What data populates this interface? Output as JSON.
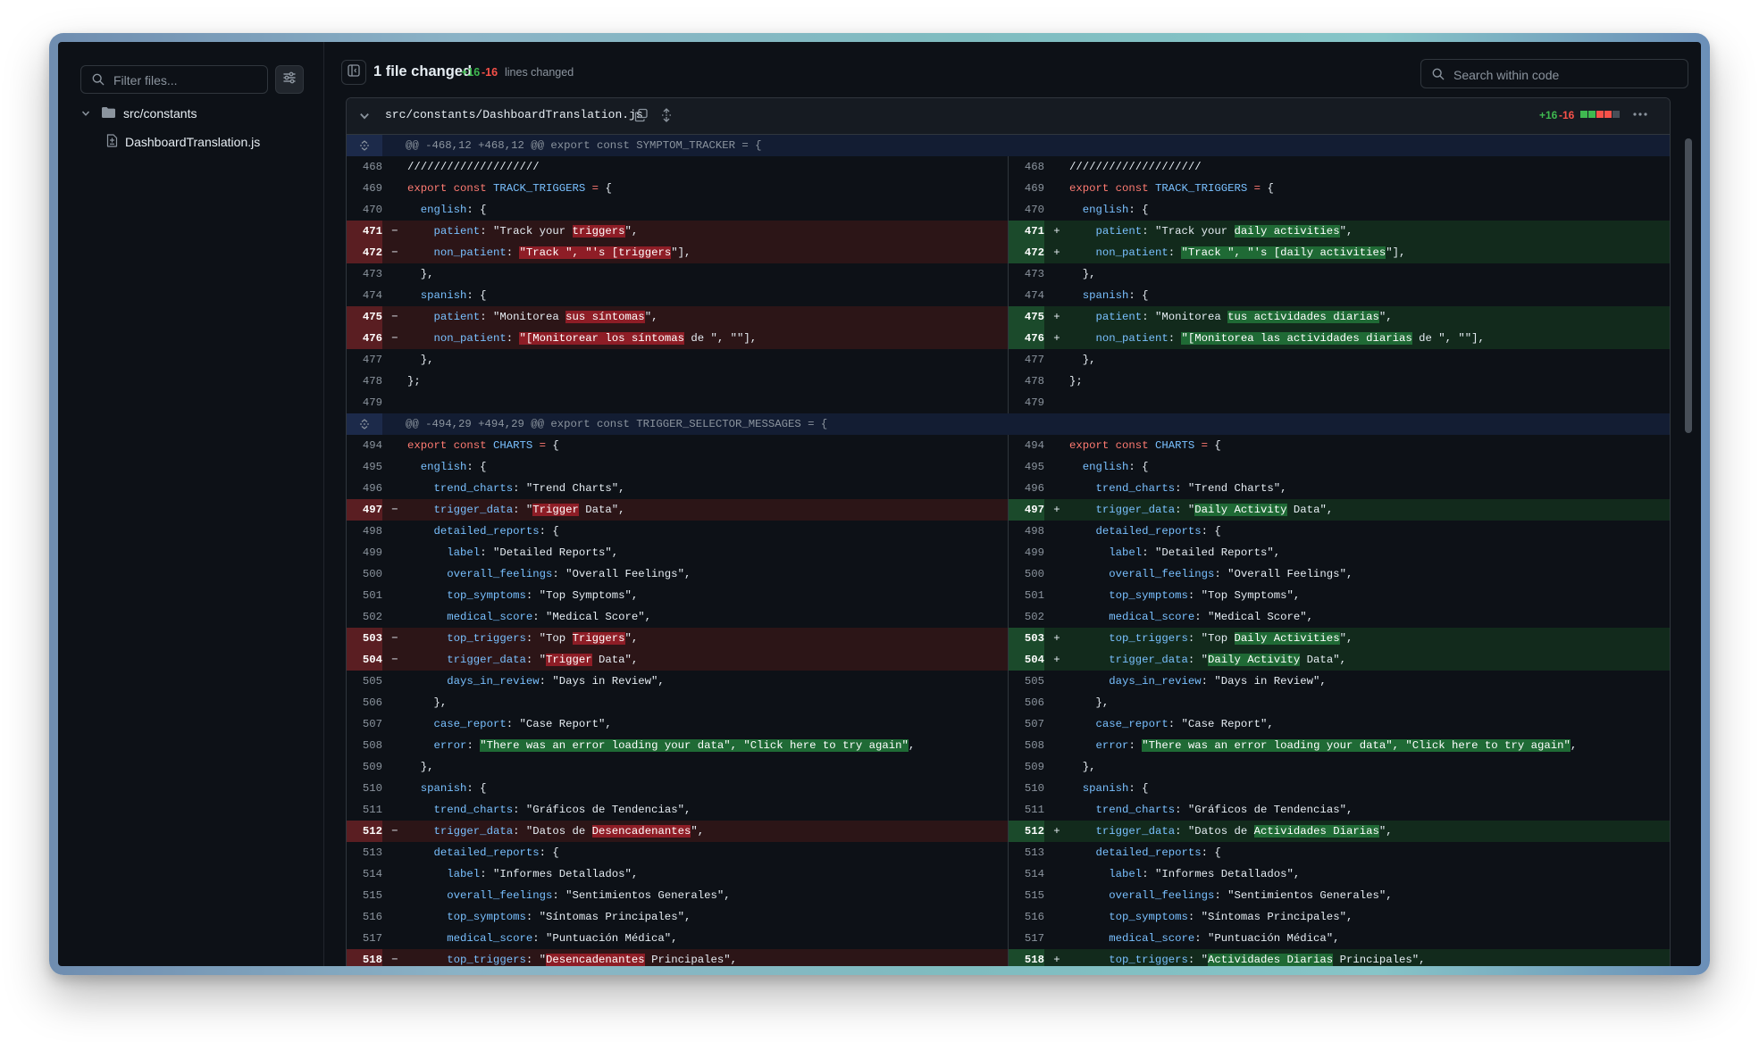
{
  "sidebar": {
    "filter_placeholder": "Filter files...",
    "folder": "src/constants",
    "file": "DashboardTranslation.js"
  },
  "header": {
    "title": "1 file changed",
    "additions": "+16",
    "deletions": "-16",
    "stat_label": "lines changed",
    "search_placeholder": "Search within code"
  },
  "file": {
    "path": "src/constants/DashboardTranslation.js",
    "additions": "+16",
    "deletions": "-16",
    "colors": {
      "add": "#3fb950",
      "del": "#f85149",
      "neutral": "#484f58"
    }
  },
  "hunks": [
    "@@ -468,12 +468,12 @@ export const SYMPTOM_TRACKER = {",
    "@@ -494,29 +494,29 @@ export const TRIGGER_SELECTOR_MESSAGES = {"
  ],
  "lines": [
    {
      "t": "h",
      "h": 0
    },
    {
      "t": "c",
      "l": 468,
      "r": 468,
      "code": "////////////////////"
    },
    {
      "t": "c",
      "l": 469,
      "r": 469,
      "code": "export const TRACK_TRIGGERS = {"
    },
    {
      "t": "c",
      "l": 470,
      "r": 470,
      "code": "  english: {"
    },
    {
      "t": "d",
      "l": 471,
      "r": 471,
      "lc": "    patient: \"Track your [triggers]\",",
      "rc": "    patient: \"Track your [daily activities]\","
    },
    {
      "t": "d",
      "l": 472,
      "r": 472,
      "lc": "    non_patient: [\"Track \", \"'s [triggers]\"],",
      "rc": "    non_patient: [\"Track \", \"'s [daily activities]\"],"
    },
    {
      "t": "c",
      "l": 473,
      "r": 473,
      "code": "  },"
    },
    {
      "t": "c",
      "l": 474,
      "r": 474,
      "code": "  spanish: {"
    },
    {
      "t": "d",
      "l": 475,
      "r": 475,
      "lc": "    patient: \"Monitorea [sus síntomas]\",",
      "rc": "    patient: \"Monitorea [tus actividades diarias]\","
    },
    {
      "t": "d",
      "l": 476,
      "r": 476,
      "lc": "    non_patient: [\"[Monitorear los síntomas] de \", \"\"],",
      "rc": "    non_patient: [\"[Monitorea las actividades diarias] de \", \"\"],"
    },
    {
      "t": "c",
      "l": 477,
      "r": 477,
      "code": "  },"
    },
    {
      "t": "c",
      "l": 478,
      "r": 478,
      "code": "};"
    },
    {
      "t": "c",
      "l": 479,
      "r": 479,
      "code": ""
    },
    {
      "t": "h",
      "h": 1
    },
    {
      "t": "c",
      "l": 494,
      "r": 494,
      "code": "export const CHARTS = {"
    },
    {
      "t": "c",
      "l": 495,
      "r": 495,
      "code": "  english: {"
    },
    {
      "t": "c",
      "l": 496,
      "r": 496,
      "code": "    trend_charts: \"Trend Charts\","
    },
    {
      "t": "d",
      "l": 497,
      "r": 497,
      "lc": "    trigger_data: \"[Trigger] Data\",",
      "rc": "    trigger_data: \"[Daily Activity] Data\","
    },
    {
      "t": "c",
      "l": 498,
      "r": 498,
      "code": "    detailed_reports: {"
    },
    {
      "t": "c",
      "l": 499,
      "r": 499,
      "code": "      label: \"Detailed Reports\","
    },
    {
      "t": "c",
      "l": 500,
      "r": 500,
      "code": "      overall_feelings: \"Overall Feelings\","
    },
    {
      "t": "c",
      "l": 501,
      "r": 501,
      "code": "      top_symptoms: \"Top Symptoms\","
    },
    {
      "t": "c",
      "l": 502,
      "r": 502,
      "code": "      medical_score: \"Medical Score\","
    },
    {
      "t": "d",
      "l": 503,
      "r": 503,
      "lc": "      top_triggers: \"Top [Triggers]\",",
      "rc": "      top_triggers: \"Top [Daily Activities]\","
    },
    {
      "t": "d",
      "l": 504,
      "r": 504,
      "lc": "      trigger_data: \"[Trigger] Data\",",
      "rc": "      trigger_data: \"[Daily Activity] Data\","
    },
    {
      "t": "c",
      "l": 505,
      "r": 505,
      "code": "      days_in_review: \"Days in Review\","
    },
    {
      "t": "c",
      "l": 506,
      "r": 506,
      "code": "    },"
    },
    {
      "t": "c",
      "l": 507,
      "r": 507,
      "code": "    case_report: \"Case Report\","
    },
    {
      "t": "c",
      "l": 508,
      "r": 508,
      "code": "    error: [\"There was an error loading your data\", \"Click here to try again\"],"
    },
    {
      "t": "c",
      "l": 509,
      "r": 509,
      "code": "  },"
    },
    {
      "t": "c",
      "l": 510,
      "r": 510,
      "code": "  spanish: {"
    },
    {
      "t": "c",
      "l": 511,
      "r": 511,
      "code": "    trend_charts: \"Gráficos de Tendencias\","
    },
    {
      "t": "d",
      "l": 512,
      "r": 512,
      "lc": "    trigger_data: \"Datos de [Desencadenantes]\",",
      "rc": "    trigger_data: \"Datos de [Actividades Diarias]\","
    },
    {
      "t": "c",
      "l": 513,
      "r": 513,
      "code": "    detailed_reports: {"
    },
    {
      "t": "c",
      "l": 514,
      "r": 514,
      "code": "      label: \"Informes Detallados\","
    },
    {
      "t": "c",
      "l": 515,
      "r": 515,
      "code": "      overall_feelings: \"Sentimientos Generales\","
    },
    {
      "t": "c",
      "l": 516,
      "r": 516,
      "code": "      top_symptoms: \"Síntomas Principales\","
    },
    {
      "t": "c",
      "l": 517,
      "r": 517,
      "code": "      medical_score: \"Puntuación Médica\","
    },
    {
      "t": "d",
      "l": 518,
      "r": 518,
      "lc": "      top_triggers: \"[Desencadenantes] Principales\",",
      "rc": "      top_triggers: \"[Actividades Diarias] Principales\","
    }
  ]
}
